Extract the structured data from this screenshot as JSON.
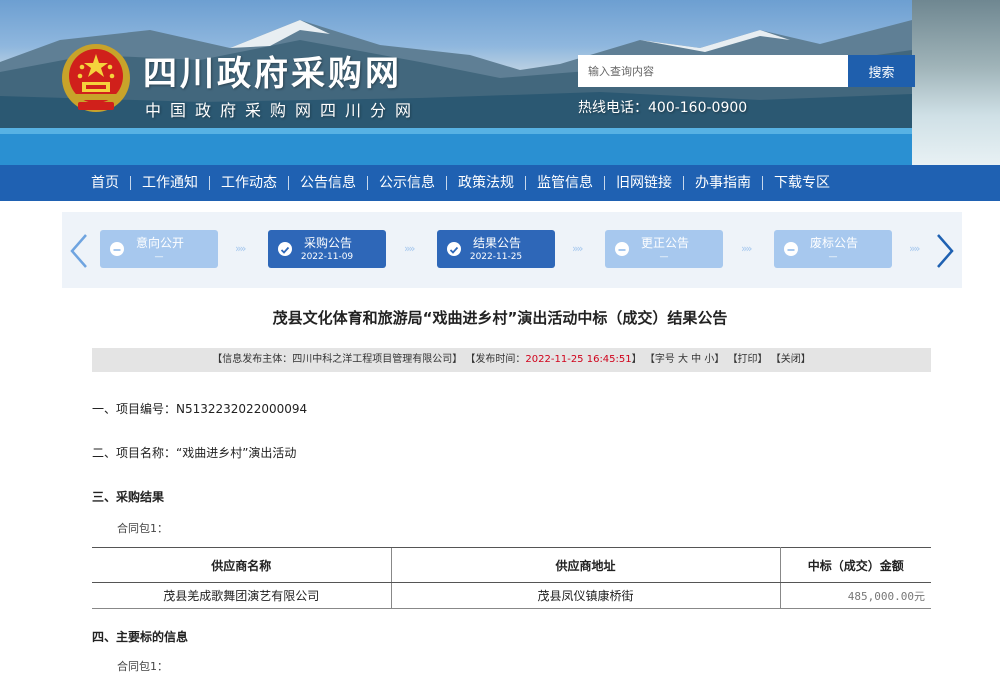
{
  "header": {
    "title": "四川政府采购网",
    "subtitle": "中国政府采购网四川分网",
    "search_placeholder": "输入查询内容",
    "search_button": "搜索",
    "hotline": "热线电话：400-160-0900"
  },
  "nav": {
    "items": [
      "首页",
      "工作通知",
      "工作动态",
      "公告信息",
      "公示信息",
      "政策法规",
      "监管信息",
      "旧网链接",
      "办事指南",
      "下载专区"
    ]
  },
  "steps": {
    "items": [
      {
        "label": "意向公开",
        "date": "—",
        "active": false,
        "icon": "minus-circle-icon"
      },
      {
        "label": "采购公告",
        "date": "2022-11-09",
        "active": true,
        "icon": "check-circle-icon"
      },
      {
        "label": "结果公告",
        "date": "2022-11-25",
        "active": true,
        "icon": "check-circle-icon"
      },
      {
        "label": "更正公告",
        "date": "—",
        "active": false,
        "icon": "minus-circle-icon"
      },
      {
        "label": "废标公告",
        "date": "—",
        "active": false,
        "icon": "minus-circle-icon"
      }
    ]
  },
  "article": {
    "title": "茂县文化体育和旅游局“戏曲进乡村”演出活动中标（成交）结果公告",
    "info": {
      "publisher": "【信息发布主体：四川中科之洋工程项目管理有限公司】",
      "time_label": "【发布时间：",
      "time_value": "2022-11-25 16:45:51",
      "time_end": "】",
      "font_size": "【字号 大 中 小】",
      "print": "【打印】",
      "close": "【关闭】"
    },
    "section1": "一、项目编号：N5132232022000094",
    "section2": "二、项目名称：“戏曲进乡村”演出活动",
    "section3": "三、采购结果",
    "contract1": "合同包1：",
    "table": {
      "headers": [
        "供应商名称",
        "供应商地址",
        "中标（成交）金额"
      ],
      "rows": [
        [
          "茂县羌成歌舞团演艺有限公司",
          "茂县凤仪镇康桥街",
          "485,000.00元"
        ]
      ]
    },
    "section4": "四、主要标的信息",
    "contract2": "合同包1："
  },
  "colors": {
    "nav_bg": "#1f61b2",
    "step_active": "#2e67b8",
    "step_inactive": "#a7c8ee",
    "highlight_red": "#d0021b"
  }
}
